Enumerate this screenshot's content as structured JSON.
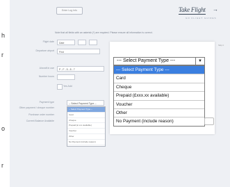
{
  "left_fragments": [
    "h",
    "r",
    "o",
    "r"
  ],
  "header": {
    "small_button_label": "Enter Log Info",
    "logo_text": "Take Flight",
    "logo_arrow": "→",
    "logo_sub": "GO FLIGHT GUIDES"
  },
  "notice": "Note that all fields with an asterisk (*) are required. Please ensure all information is correct.",
  "skip_link": "Skip it",
  "form": {
    "rows": [
      {
        "label": "Flight date",
        "value": "Date"
      },
      {
        "label": "Departure airport",
        "value": "Find"
      },
      {
        "label": "Aircraft in use",
        "value": "P - F - 5 - 8 - 7"
      },
      {
        "label": "Number hours",
        "value": ""
      },
      {
        "label": "Payment type",
        "value": "-- Select Payment Type --"
      },
      {
        "label": "Other payment / cheque number",
        "value": ""
      },
      {
        "label": "Purchase order number",
        "value": ""
      },
      {
        "label": "Current Balance Available",
        "value": ""
      }
    ],
    "checkbox_label": "Yes Add"
  },
  "mini_dropdown": {
    "options": [
      "-- Select Payment Type --",
      "Card",
      "Cheque",
      "Prepaid (£ xxx available)",
      "Voucher",
      "Other",
      "No Payment (include reason)"
    ],
    "selected_index": 0
  },
  "payment_select": {
    "current_value": "--- Select Payment Type ---",
    "arrow_glyph": "▼",
    "options": [
      "--- Select Payment Type ---",
      "Card",
      "Cheque",
      "Prepaid (£xxx.xx available)",
      "Voucher",
      "Other",
      "No Payment (include reason)"
    ],
    "selected_index": 0
  },
  "colors": {
    "page_bg": "#eef0f4",
    "selected_option": "#3b7fe0",
    "logo": "#394656"
  }
}
